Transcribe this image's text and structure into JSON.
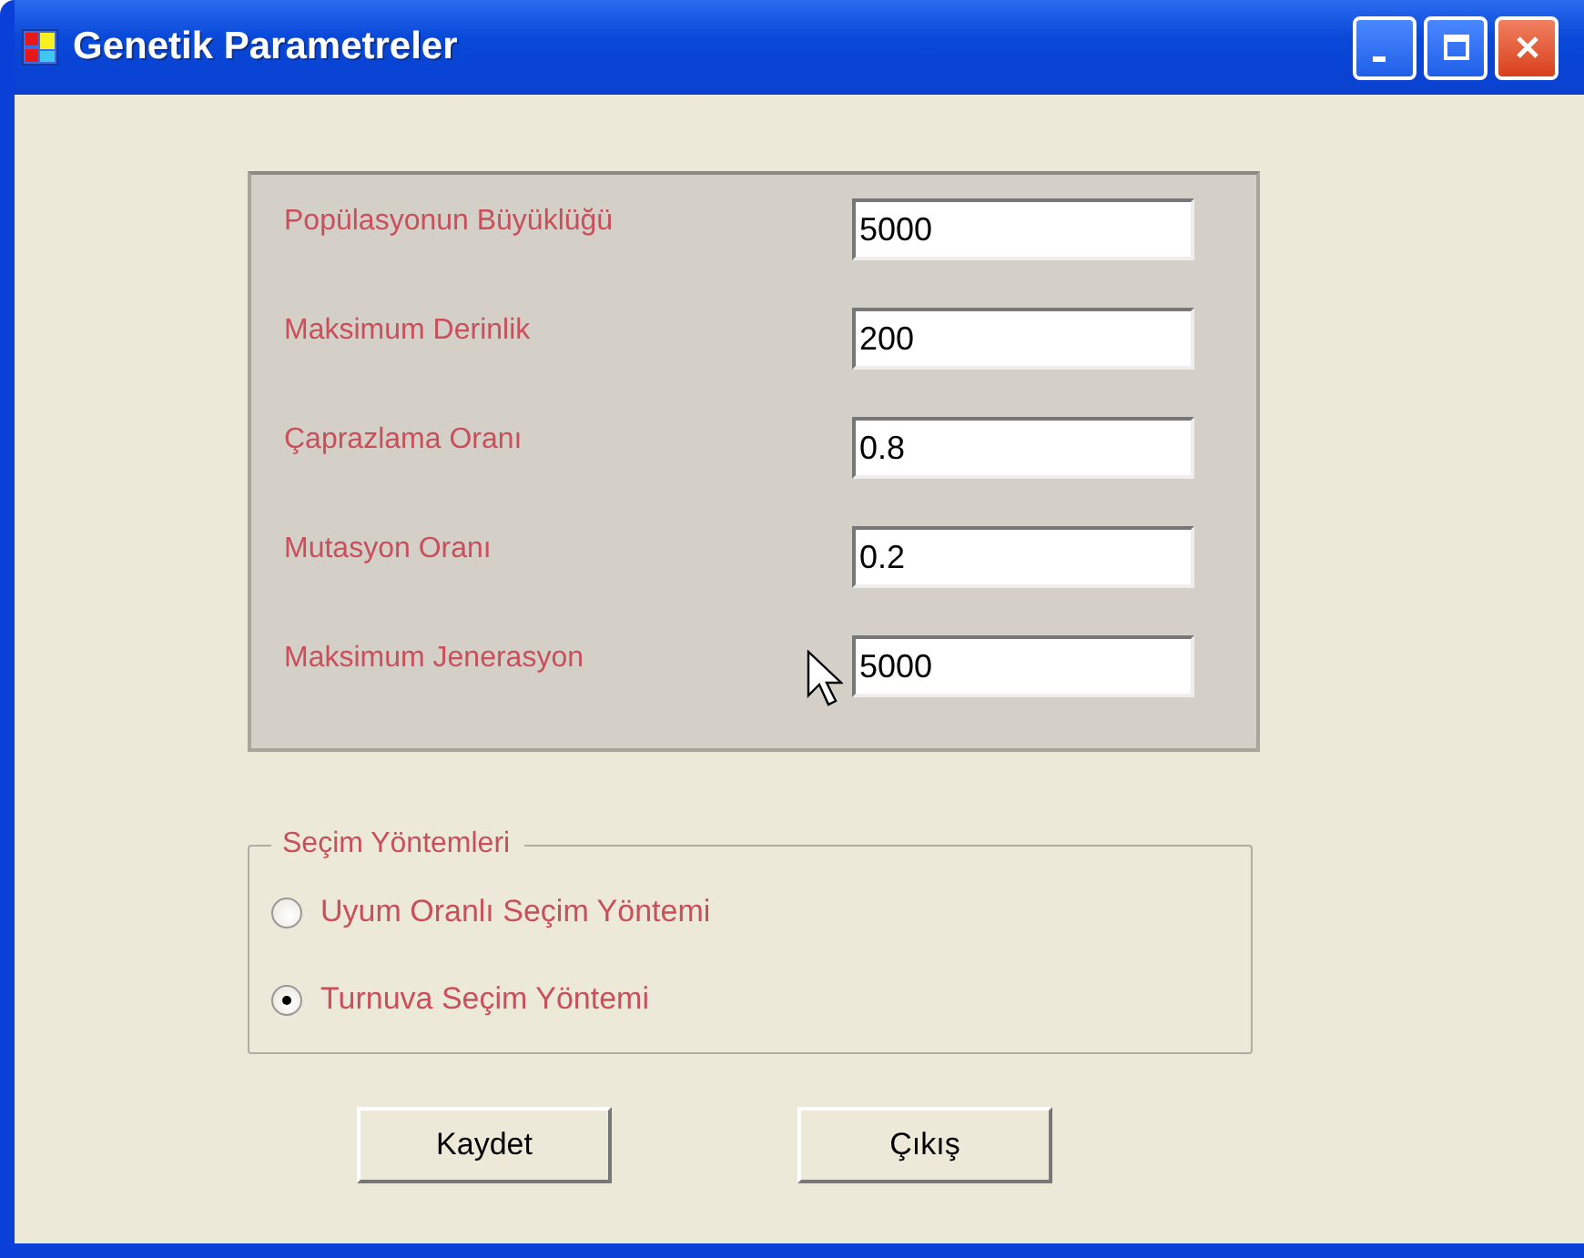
{
  "window": {
    "title": "Genetik Parametreler"
  },
  "parameters": [
    {
      "label": "Popülasyonun Büyüklüğü",
      "value": "5000"
    },
    {
      "label": "Maksimum Derinlik",
      "value": "200"
    },
    {
      "label": "Çaprazlama Oranı",
      "value": "0.8"
    },
    {
      "label": "Mutasyon Oranı",
      "value": "0.2"
    },
    {
      "label": "Maksimum Jenerasyon",
      "value": "5000"
    }
  ],
  "selection_methods": {
    "title": "Seçim Yöntemleri",
    "options": [
      {
        "label": "Uyum Oranlı Seçim Yöntemi",
        "selected": false
      },
      {
        "label": "Turnuva Seçim Yöntemi",
        "selected": true
      }
    ]
  },
  "buttons": [
    "Kaydet",
    "Çıkış"
  ]
}
